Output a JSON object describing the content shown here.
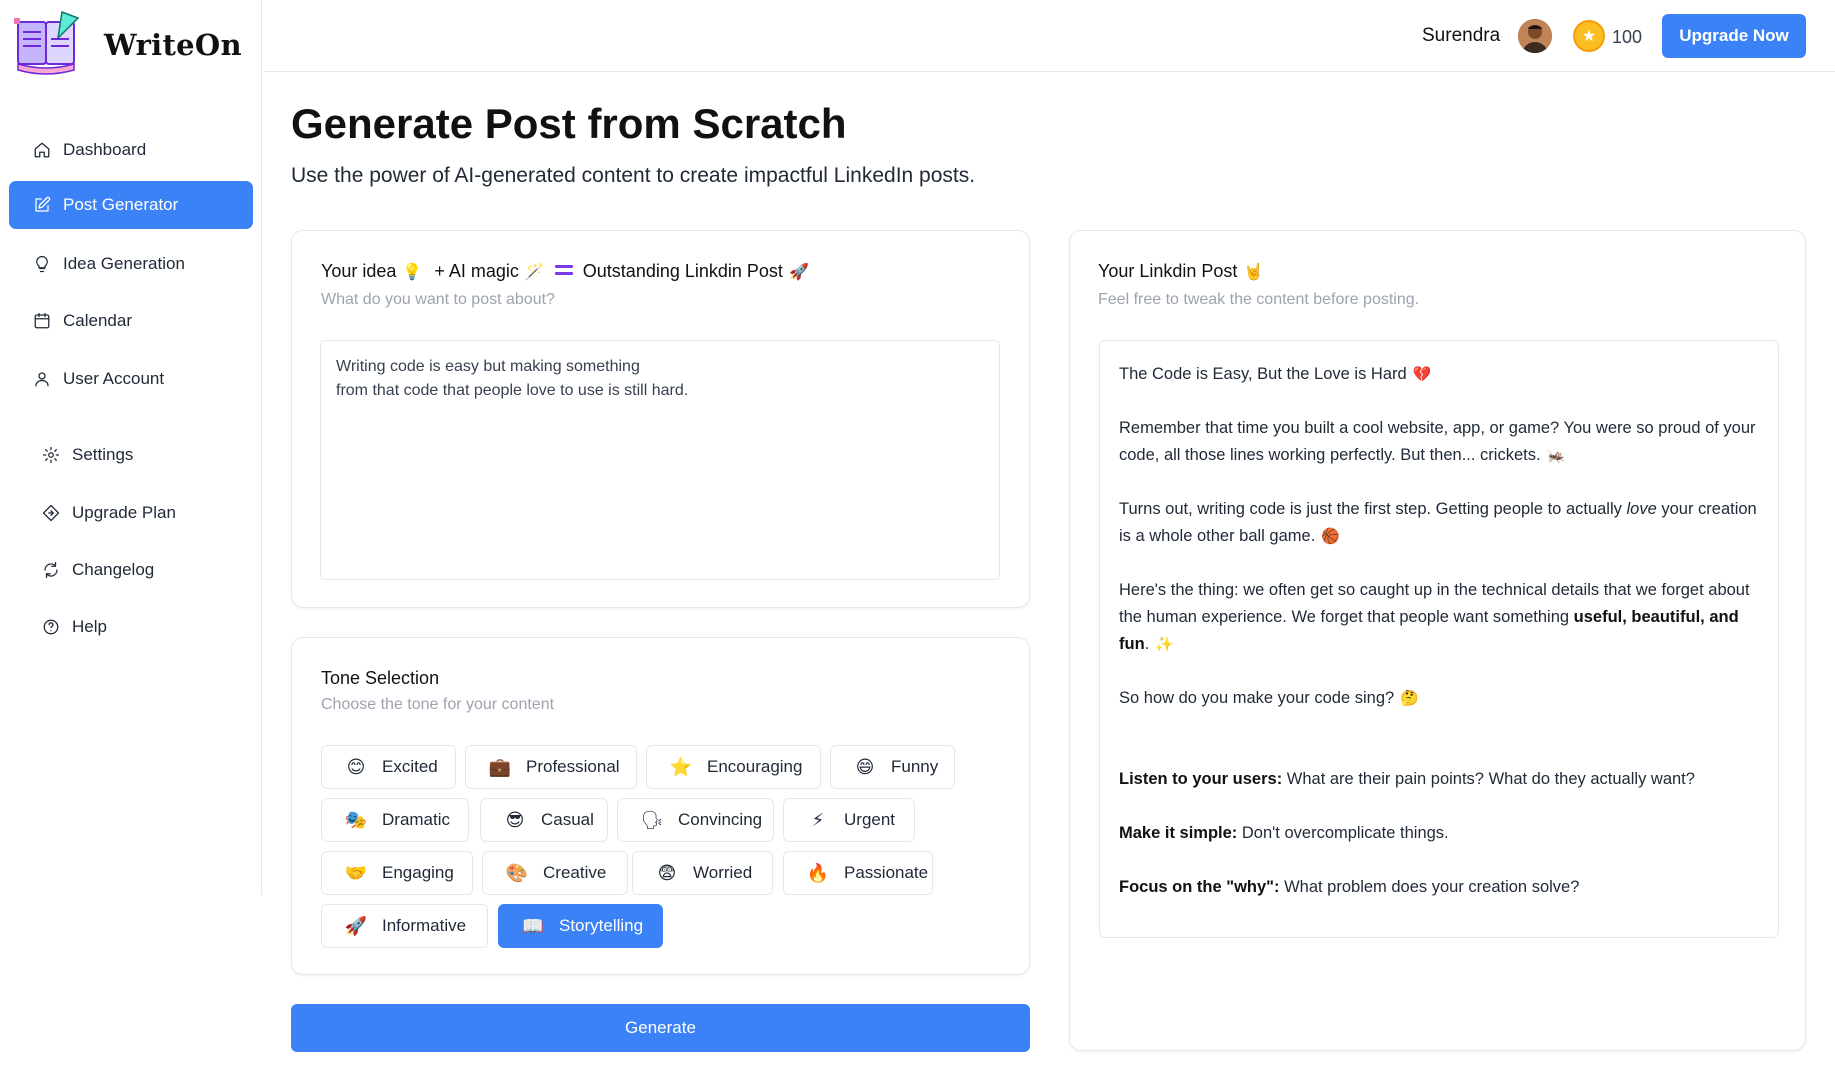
{
  "app": {
    "name": "WriteOn"
  },
  "sidebar": {
    "items": [
      {
        "label": "Dashboard",
        "icon": "home-icon"
      },
      {
        "label": "Post Generator",
        "icon": "edit-icon",
        "active": true
      },
      {
        "label": "Idea Generation",
        "icon": "lightbulb-icon"
      },
      {
        "label": "Calendar",
        "icon": "calendar-icon"
      },
      {
        "label": "User Account",
        "icon": "user-icon"
      },
      {
        "label": "Settings",
        "icon": "gear-icon"
      },
      {
        "label": "Upgrade Plan",
        "icon": "diamond-icon"
      },
      {
        "label": "Changelog",
        "icon": "refresh-icon"
      },
      {
        "label": "Help",
        "icon": "help-icon"
      }
    ]
  },
  "header": {
    "user_name": "Surendra",
    "coins": "100",
    "upgrade_label": "Upgrade Now"
  },
  "page": {
    "title": "Generate Post from Scratch",
    "subtitle": "Use the power of AI-generated content to create impactful LinkedIn posts."
  },
  "idea_card": {
    "title_part1": "Your idea",
    "title_part2": "+ AI magic",
    "title_part3": "Outstanding Linkdin Post",
    "subtitle": "What do you want to post about?",
    "input_value": "Writing code is easy but making something\nfrom that code that people love to use is still hard."
  },
  "tone_card": {
    "title": "Tone Selection",
    "subtitle": "Choose the tone for your content",
    "tones": [
      {
        "label": "Excited",
        "emoji": "😊"
      },
      {
        "label": "Professional",
        "emoji": "💼"
      },
      {
        "label": "Encouraging",
        "emoji": "⭐"
      },
      {
        "label": "Funny",
        "emoji": "😄"
      },
      {
        "label": "Dramatic",
        "emoji": "🎭"
      },
      {
        "label": "Casual",
        "emoji": "😎"
      },
      {
        "label": "Convincing",
        "emoji": "🗣"
      },
      {
        "label": "Urgent",
        "emoji": "⚡"
      },
      {
        "label": "Engaging",
        "emoji": "🤝"
      },
      {
        "label": "Creative",
        "emoji": "🎨"
      },
      {
        "label": "Worried",
        "emoji": "😨"
      },
      {
        "label": "Passionate",
        "emoji": "🔥"
      },
      {
        "label": "Informative",
        "emoji": "🚀"
      },
      {
        "label": "Storytelling",
        "emoji": "📖",
        "selected": true
      }
    ]
  },
  "generate_label": "Generate",
  "post_card": {
    "title": "Your Linkdin Post",
    "subtitle": "Feel free to tweak the content before posting.",
    "p1": "The Code is Easy, But the Love is Hard",
    "p2": "Remember that time you built a cool website, app, or game? You were so proud of your code, all those lines working perfectly. But then... crickets.",
    "p3a": "Turns out, writing code is just the first step. Getting people to actually ",
    "p3b": "love",
    "p3c": " your creation is a whole other ball game.",
    "p4a": "Here's the thing:  we often get so caught up in the technical details that we forget about the human experience. We forget that people want something ",
    "p4b": "useful, beautiful, and fun",
    "p4c": ".",
    "p5": "So how do you make your code sing?",
    "b1": "Listen to your users:",
    "b1t": " What are their pain points? What do they actually want?",
    "b2": "Make it simple:",
    "b2t": " Don't overcomplicate things.",
    "b3": "Focus on the \"why\":",
    "b3t": "  What problem does your creation solve?"
  }
}
